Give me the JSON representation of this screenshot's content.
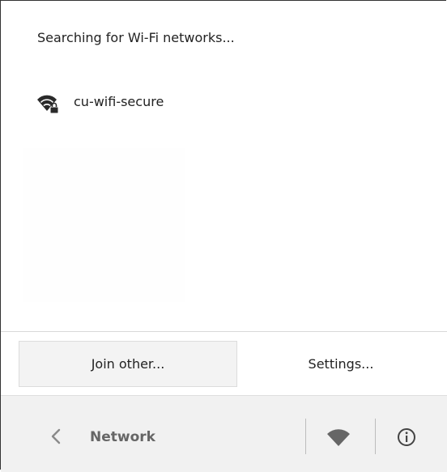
{
  "status": {
    "text": "Searching for Wi-Fi networks..."
  },
  "networks": [
    {
      "name": "cu-wifi-secure",
      "icon": "wifi-secure-icon",
      "secured": true
    }
  ],
  "actions": {
    "join_label": "Join other...",
    "settings_label": "Settings..."
  },
  "footer": {
    "title": "Network",
    "back_icon": "chevron-left-icon",
    "wifi_icon": "wifi-icon",
    "info_icon": "info-icon"
  },
  "colors": {
    "text": "#222222",
    "muted": "#666666",
    "footer_bg": "#f1f1f1",
    "button_bg": "#f3f3f3"
  }
}
